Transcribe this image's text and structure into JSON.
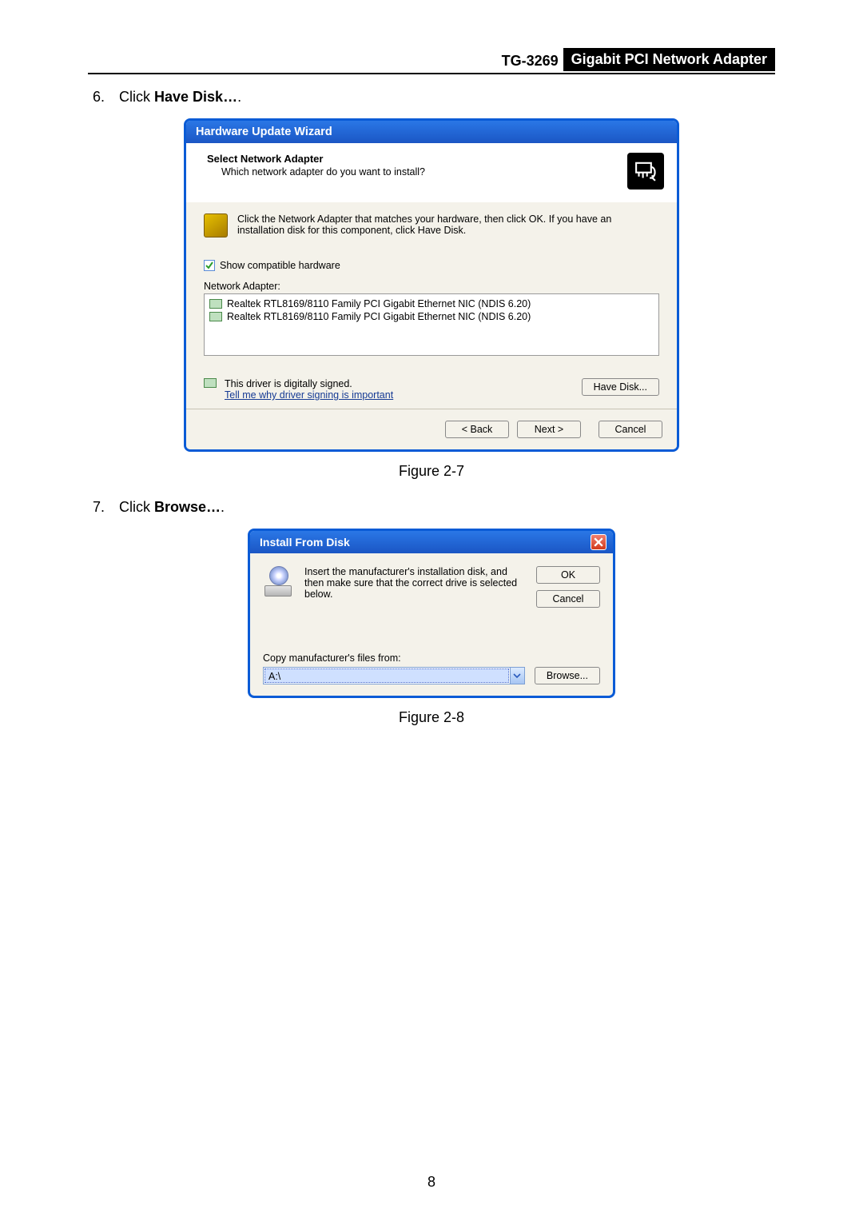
{
  "header": {
    "model": "TG-3269",
    "title": "Gigabit PCI Network Adapter"
  },
  "step6": {
    "num": "6.",
    "prefix": "Click ",
    "bold": "Have Disk…",
    "suffix": "."
  },
  "wizard": {
    "title": "Hardware Update Wizard",
    "heading": "Select Network Adapter",
    "subheading": "Which network adapter do you want to install?",
    "info": "Click the Network Adapter that matches your hardware, then click OK. If you have an installation disk for this component, click Have Disk.",
    "show_compatible": "Show compatible hardware",
    "na_label": "Network Adapter:",
    "items": [
      "Realtek RTL8169/8110 Family PCI Gigabit Ethernet NIC (NDIS 6.20)",
      "Realtek RTL8169/8110 Family PCI Gigabit Ethernet NIC (NDIS 6.20)"
    ],
    "signed": "This driver is digitally signed.",
    "signing_link": "Tell me why driver signing is important",
    "have_disk": "Have Disk...",
    "back": "< Back",
    "next": "Next >",
    "cancel": "Cancel"
  },
  "fig1": "Figure 2-7",
  "step7": {
    "num": "7.",
    "prefix": "Click ",
    "bold": "Browse…",
    "suffix": "."
  },
  "dialog": {
    "title": "Install From Disk",
    "msg": "Insert the manufacturer's installation disk, and then make sure that the correct drive is selected below.",
    "ok": "OK",
    "cancel": "Cancel",
    "copy_label": "Copy manufacturer's files from:",
    "path": "A:\\",
    "browse": "Browse..."
  },
  "fig2": "Figure 2-8",
  "page_number": "8"
}
